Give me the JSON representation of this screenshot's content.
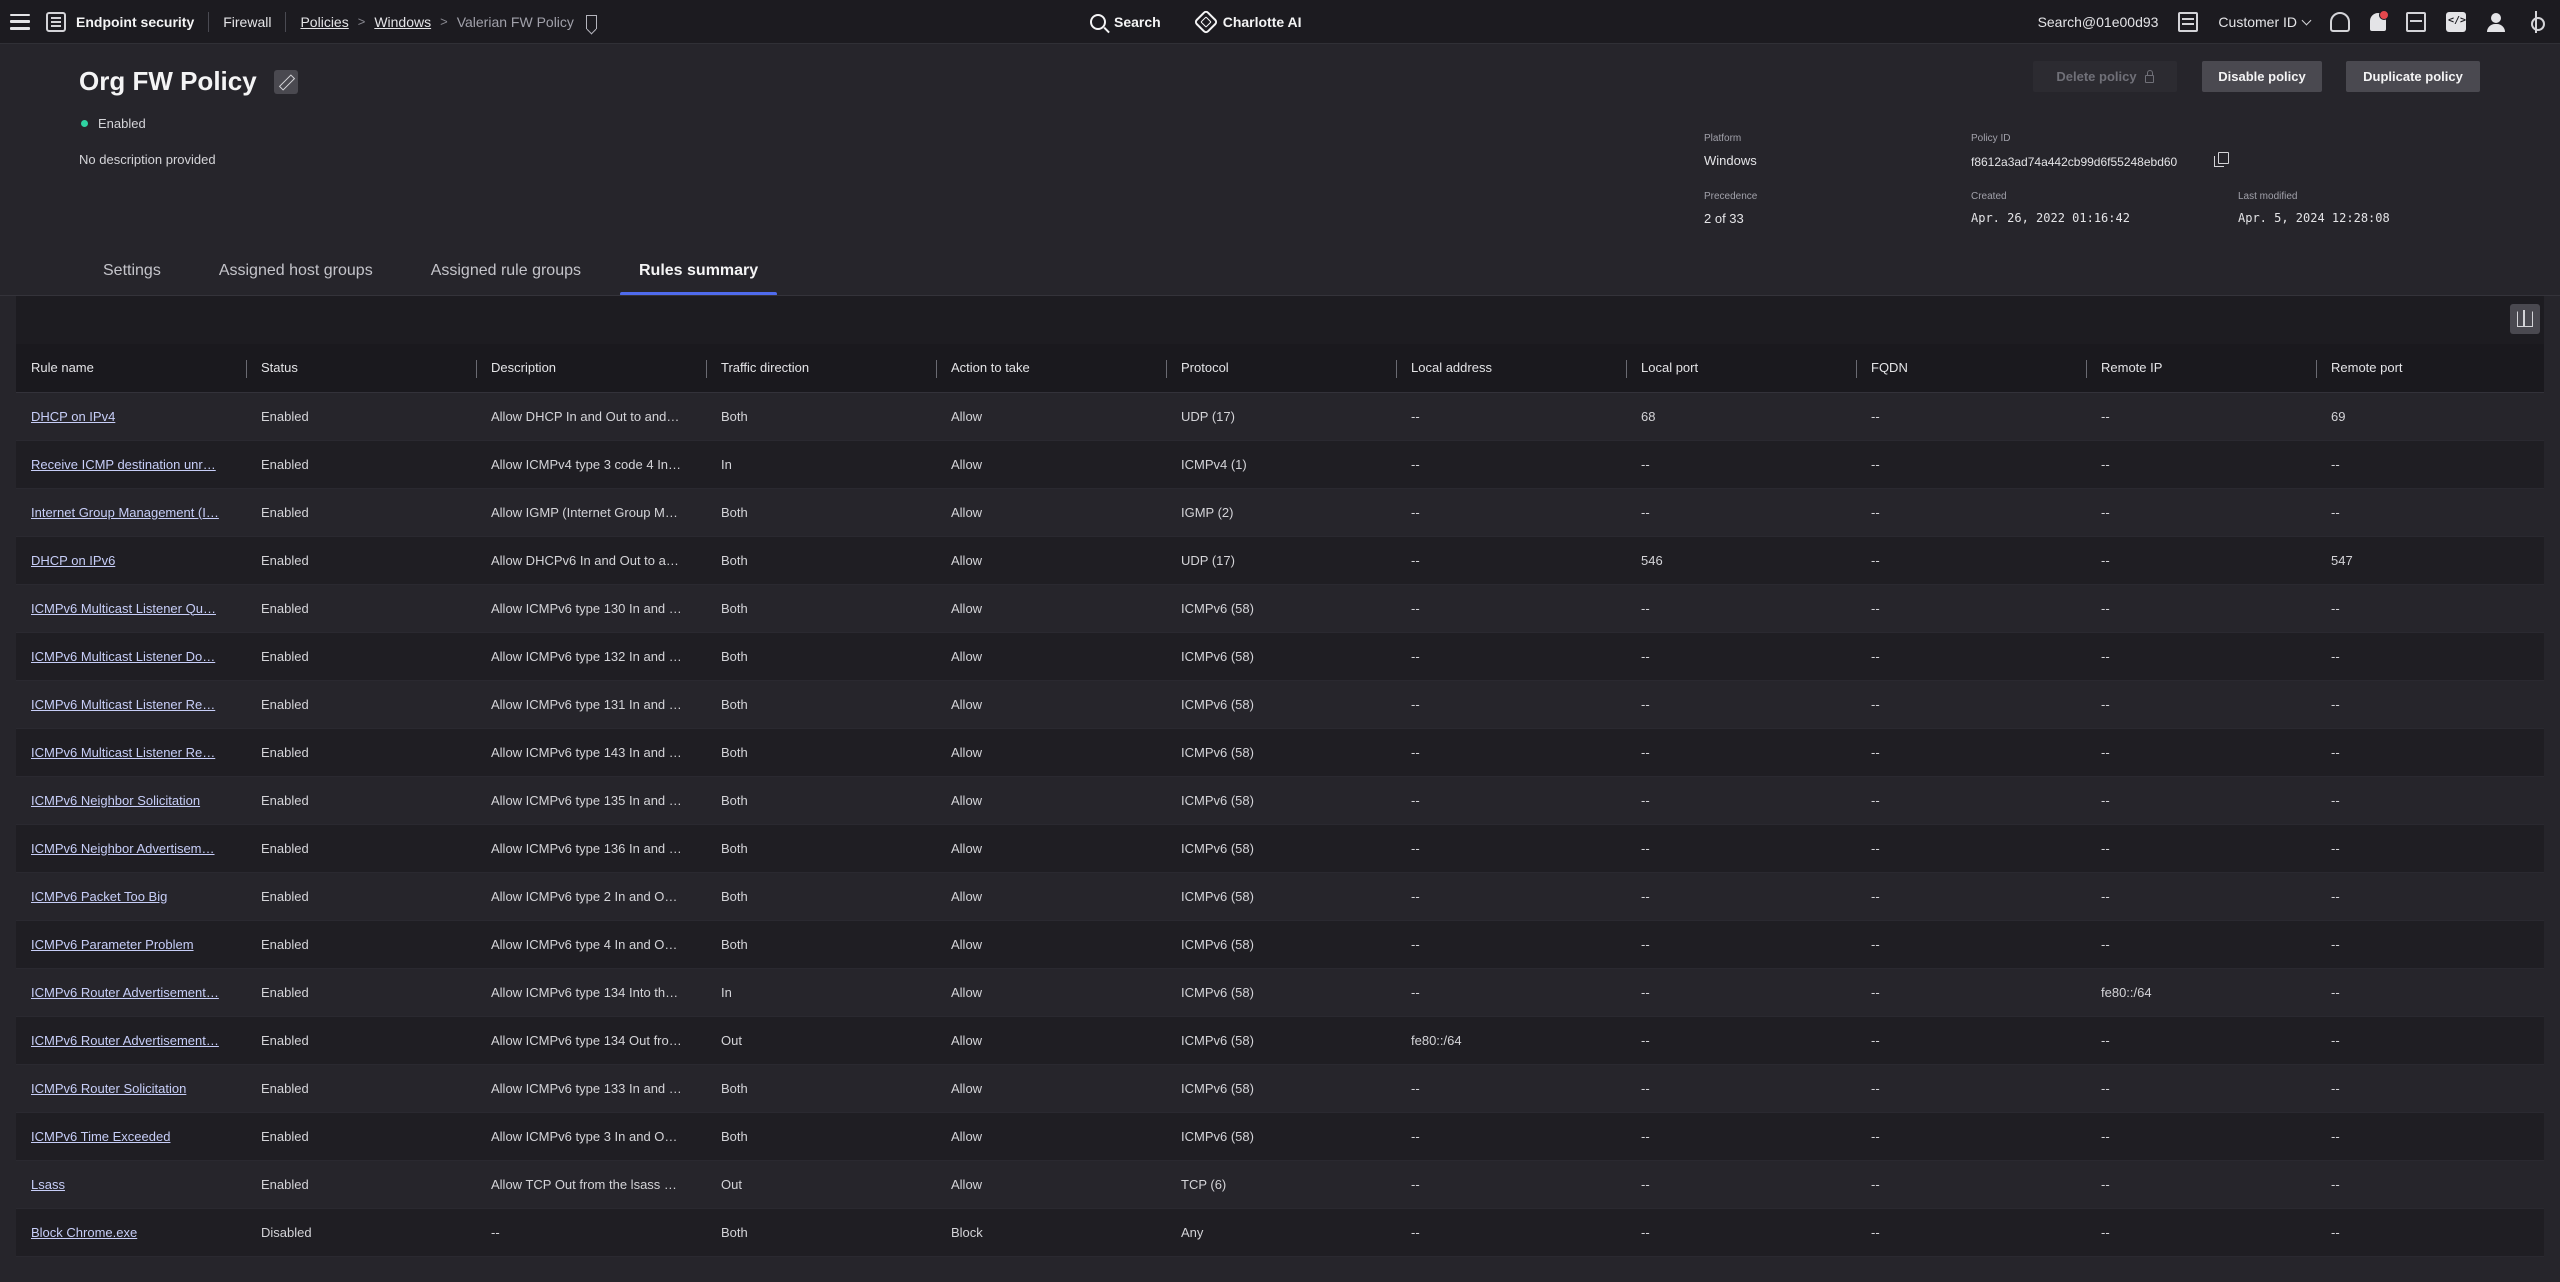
{
  "topbar": {
    "app_name": "Endpoint security",
    "section": "Firewall",
    "breadcrumb": [
      "Policies",
      "Windows"
    ],
    "current": "Valerian FW Policy",
    "search_label": "Search",
    "ai_label": "Charlotte AI",
    "account": "Search@01e00d93",
    "customer_label": "Customer ID"
  },
  "policy": {
    "title": "Org FW Policy",
    "status": "Enabled",
    "status_color": "#2fd3a2",
    "description": "No description provided",
    "buttons": {
      "delete": "Delete policy",
      "disable": "Disable policy",
      "duplicate": "Duplicate policy"
    },
    "meta": {
      "platform_label": "Platform",
      "platform": "Windows",
      "policy_id_label": "Policy ID",
      "policy_id": "f8612a3ad74a442cb99d6f55248ebd60",
      "precedence_label": "Precedence",
      "precedence": "2 of 33",
      "created_label": "Created",
      "created": "Apr. 26, 2022 01:16:42",
      "modified_label": "Last modified",
      "modified": "Apr. 5, 2024 12:28:08"
    }
  },
  "tabs": [
    "Settings",
    "Assigned host groups",
    "Assigned rule groups",
    "Rules summary"
  ],
  "active_tab": "Rules summary",
  "accent": "#4f6bed",
  "columns": [
    "Rule name",
    "Status",
    "Description",
    "Traffic direction",
    "Action to take",
    "Protocol",
    "Local address",
    "Local port",
    "FQDN",
    "Remote IP",
    "Remote port"
  ],
  "rows": [
    [
      "DHCP on IPv4",
      "Enabled",
      "Allow DHCP In and Out to and…",
      "Both",
      "Allow",
      "UDP (17)",
      "--",
      "68",
      "--",
      "--",
      "69"
    ],
    [
      "Receive ICMP destination unr…",
      "Enabled",
      "Allow ICMPv4 type 3 code 4 In…",
      "In",
      "Allow",
      "ICMPv4 (1)",
      "--",
      "--",
      "--",
      "--",
      "--"
    ],
    [
      "Internet Group Management (I…",
      "Enabled",
      "Allow IGMP (Internet Group M…",
      "Both",
      "Allow",
      "IGMP (2)",
      "--",
      "--",
      "--",
      "--",
      "--"
    ],
    [
      "DHCP on IPv6",
      "Enabled",
      "Allow DHCPv6 In and Out to a…",
      "Both",
      "Allow",
      "UDP (17)",
      "--",
      "546",
      "--",
      "--",
      "547"
    ],
    [
      "ICMPv6 Multicast Listener Qu…",
      "Enabled",
      "Allow ICMPv6 type 130 In and …",
      "Both",
      "Allow",
      "ICMPv6 (58)",
      "--",
      "--",
      "--",
      "--",
      "--"
    ],
    [
      "ICMPv6 Multicast Listener Do…",
      "Enabled",
      "Allow ICMPv6 type 132 In and …",
      "Both",
      "Allow",
      "ICMPv6 (58)",
      "--",
      "--",
      "--",
      "--",
      "--"
    ],
    [
      "ICMPv6 Multicast Listener Re…",
      "Enabled",
      "Allow ICMPv6 type 131 In and …",
      "Both",
      "Allow",
      "ICMPv6 (58)",
      "--",
      "--",
      "--",
      "--",
      "--"
    ],
    [
      "ICMPv6 Multicast Listener Re…",
      "Enabled",
      "Allow ICMPv6 type 143 In and …",
      "Both",
      "Allow",
      "ICMPv6 (58)",
      "--",
      "--",
      "--",
      "--",
      "--"
    ],
    [
      "ICMPv6 Neighbor Solicitation",
      "Enabled",
      "Allow ICMPv6 type 135 In and …",
      "Both",
      "Allow",
      "ICMPv6 (58)",
      "--",
      "--",
      "--",
      "--",
      "--"
    ],
    [
      "ICMPv6 Neighbor Advertisem…",
      "Enabled",
      "Allow ICMPv6 type 136 In and …",
      "Both",
      "Allow",
      "ICMPv6 (58)",
      "--",
      "--",
      "--",
      "--",
      "--"
    ],
    [
      "ICMPv6 Packet Too Big",
      "Enabled",
      "Allow ICMPv6 type 2 In and O…",
      "Both",
      "Allow",
      "ICMPv6 (58)",
      "--",
      "--",
      "--",
      "--",
      "--"
    ],
    [
      "ICMPv6 Parameter Problem",
      "Enabled",
      "Allow ICMPv6 type 4 In and O…",
      "Both",
      "Allow",
      "ICMPv6 (58)",
      "--",
      "--",
      "--",
      "--",
      "--"
    ],
    [
      "ICMPv6 Router Advertisement…",
      "Enabled",
      "Allow ICMPv6 type 134 Into th…",
      "In",
      "Allow",
      "ICMPv6 (58)",
      "--",
      "--",
      "--",
      "fe80::/64",
      "--"
    ],
    [
      "ICMPv6 Router Advertisement…",
      "Enabled",
      "Allow ICMPv6 type 134 Out fro…",
      "Out",
      "Allow",
      "ICMPv6 (58)",
      "fe80::/64",
      "--",
      "--",
      "--",
      "--"
    ],
    [
      "ICMPv6 Router Solicitation",
      "Enabled",
      "Allow ICMPv6 type 133 In and …",
      "Both",
      "Allow",
      "ICMPv6 (58)",
      "--",
      "--",
      "--",
      "--",
      "--"
    ],
    [
      "ICMPv6 Time Exceeded",
      "Enabled",
      "Allow ICMPv6 type 3 In and O…",
      "Both",
      "Allow",
      "ICMPv6 (58)",
      "--",
      "--",
      "--",
      "--",
      "--"
    ],
    [
      "Lsass",
      "Enabled",
      "Allow TCP Out from the lsass …",
      "Out",
      "Allow",
      "TCP (6)",
      "--",
      "--",
      "--",
      "--",
      "--"
    ],
    [
      "Block Chrome.exe",
      "Disabled",
      "--",
      "Both",
      "Block",
      "Any",
      "--",
      "--",
      "--",
      "--",
      "--"
    ]
  ]
}
